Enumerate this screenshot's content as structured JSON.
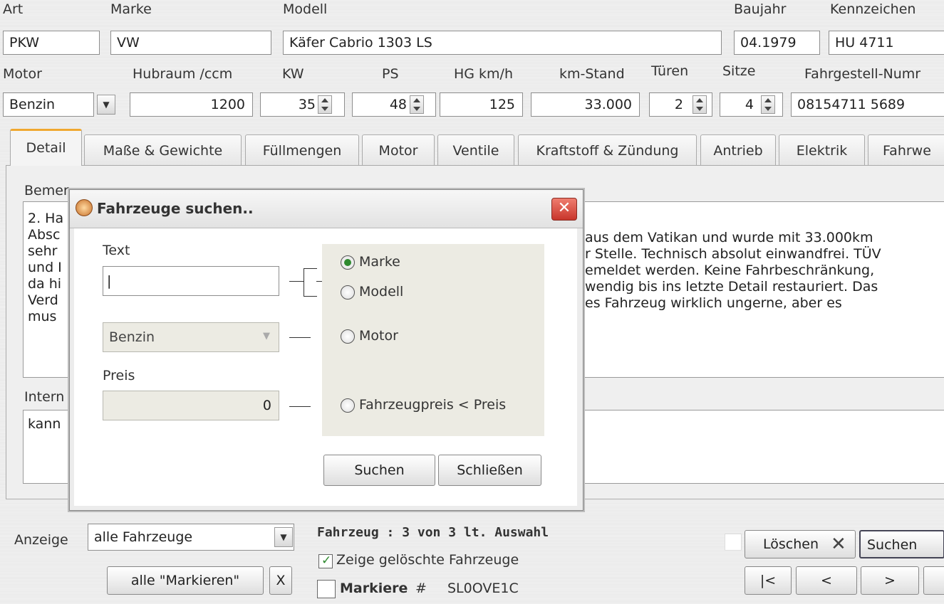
{
  "vehicle": {
    "art_label": "Art",
    "art": "PKW",
    "marke_label": "Marke",
    "marke": "VW",
    "modell_label": "Modell",
    "modell": "Käfer Cabrio 1303 LS",
    "baujahr_label": "Baujahr",
    "baujahr": "04.1979",
    "kennzeichen_label": "Kennzeichen",
    "kennzeichen": "HU 4711",
    "motor_label": "Motor",
    "motor": "Benzin",
    "hubraum_label": "Hubraum /ccm",
    "hubraum": "1200",
    "kw_label": "KW",
    "kw": "35",
    "ps_label": "PS",
    "ps": "48",
    "hg_label": "HG km/h",
    "hg": "125",
    "km_label": "km-Stand",
    "km": "33.000",
    "tueren_label": "Türen",
    "tueren": "2",
    "sitze_label": "Sitze",
    "sitze": "4",
    "fgn_label": "Fahrgestell-Numr",
    "fgn": "08154711 5689"
  },
  "tabs": [
    "Detail",
    "Maße & Gewichte",
    "Füllmengen",
    "Motor",
    "Ventile",
    "Kraftstoff & Zündung",
    "Antrieb",
    "Elektrik",
    "Fahrwe"
  ],
  "detail": {
    "bemerk_label": "Bemer",
    "remark_left": [
      "2. Ha",
      "Absc",
      "sehr",
      "und I",
      "da hi",
      "Verd",
      "mus"
    ],
    "remark_right": [
      "aus dem Vatikan und wurde mit 33.000km",
      "r Stelle. Technisch absolut einwandfrei. TÜV",
      "emeldet werden. Keine Fahrbeschränkung,",
      "wendig bis ins letzte Detail restauriert. Das",
      "es Fahrzeug wirklich ungerne, aber es"
    ],
    "intern_label": "Intern",
    "intern_text": "kann"
  },
  "dialog": {
    "title": "Fahrzeuge suchen..",
    "text_label": "Text",
    "text_value": "|",
    "motor_value": "Benzin",
    "preis_label": "Preis",
    "preis_value": "0",
    "options": [
      "Marke",
      "Modell",
      "Motor",
      "Fahrzeugpreis < Preis"
    ],
    "selected": "Marke",
    "search_btn": "Suchen",
    "close_btn": "Schließen"
  },
  "bottom": {
    "anzeige_label": "Anzeige",
    "anzeige_value": "alle Fahrzeuge",
    "status": "Fahrzeug : 3 von 3 lt. Auswahl",
    "show_deleted": "Zeige gelöschte Fahrzeuge",
    "mark_label": "Markiere",
    "mark_hash": "#",
    "mark_code": "SL0OVE1C",
    "mark_all_btn": "alle \"Markieren\"",
    "x_btn": "X",
    "delete_btn": "Löschen",
    "search_btn": "Suchen",
    "nav_first": "|<",
    "nav_prev": "<",
    "nav_next": ">"
  },
  "colors": {
    "accent_tab": "#f0a830",
    "close_red": "#d9443a",
    "radio_green": "#2f8a2f"
  }
}
